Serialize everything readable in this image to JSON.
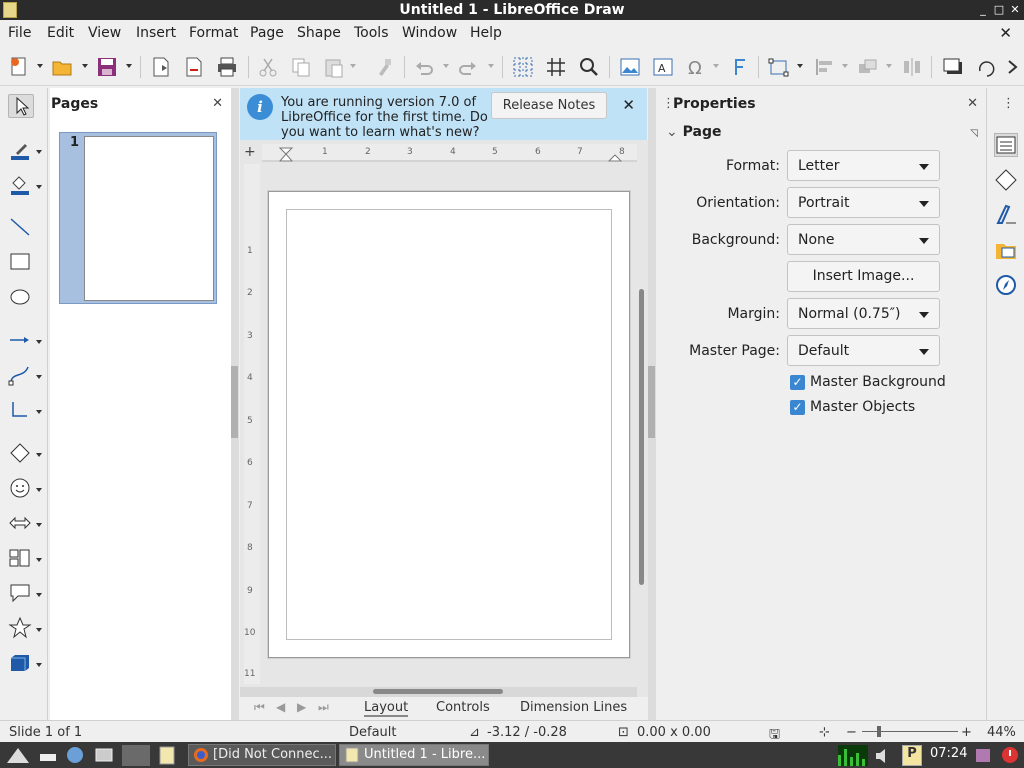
{
  "window": {
    "title": "Untitled 1 - LibreOffice Draw",
    "controls": [
      "_",
      "□",
      "✕"
    ]
  },
  "menu": [
    "File",
    "Edit",
    "View",
    "Insert",
    "Format",
    "Page",
    "Shape",
    "Tools",
    "Window",
    "Help"
  ],
  "toolbar": {
    "icons": [
      "new-icon",
      "open-icon",
      "save-icon",
      "export-icon",
      "export-pdf-icon",
      "print-icon",
      "cut-icon",
      "copy-icon",
      "paste-icon",
      "clone-formatting-icon",
      "undo-icon",
      "redo-icon",
      "grid-icon",
      "helplines-icon",
      "zoom-pan-icon",
      "image-icon",
      "textbox-icon",
      "special-character-icon",
      "fontwork-icon",
      "transformations-icon",
      "align-icon",
      "arrange-icon",
      "distribute-icon",
      "shadow-icon",
      "more-icon"
    ]
  },
  "pages_pane": {
    "title": "Pages",
    "close": "✕",
    "pages": [
      {
        "number": "1"
      }
    ]
  },
  "infobar": {
    "message": "You are running version 7.0 of LibreOffice for the first time. Do you want to learn what's new?",
    "button": "Release Notes",
    "close": "✕",
    "info_glyph": "i"
  },
  "ruler": {
    "horizontal": [
      "1",
      "2",
      "3",
      "4",
      "5",
      "6",
      "7",
      "8"
    ],
    "vertical": [
      "1",
      "2",
      "3",
      "4",
      "5",
      "6",
      "7",
      "8",
      "9",
      "10",
      "11"
    ]
  },
  "layer_tabs": {
    "tabs": [
      "Layout",
      "Controls",
      "Dimension Lines"
    ],
    "active": "Layout"
  },
  "properties": {
    "title": "Properties",
    "close": "✕",
    "section": "Page",
    "format_label": "Format:",
    "format_value": "Letter",
    "orientation_label": "Orientation:",
    "orientation_value": "Portrait",
    "background_label": "Background:",
    "background_value": "None",
    "insert_image": "Insert Image...",
    "margin_label": "Margin:",
    "margin_value": "Normal (0.75″)",
    "master_page_label": "Master Page:",
    "master_page_value": "Default",
    "master_background": "Master Background",
    "master_background_checked": true,
    "master_objects": "Master Objects",
    "master_objects_checked": true
  },
  "statusbar": {
    "slide": "Slide 1 of 1",
    "master": "Default",
    "position": "-3.12 / -0.28",
    "size": "0.00 x 0.00",
    "zoom": "44%",
    "zoom_minus": "−",
    "zoom_plus": "+"
  },
  "taskbar": {
    "tasks": [
      {
        "label": "[Did Not Connec...",
        "active": false
      },
      {
        "label": "Untitled 1 - Libre...",
        "active": true
      }
    ],
    "clock": "07:24"
  },
  "colors": {
    "accent": "#3b86d1",
    "infobar": "#bfe2f6",
    "selection": "#a8c0e0"
  }
}
